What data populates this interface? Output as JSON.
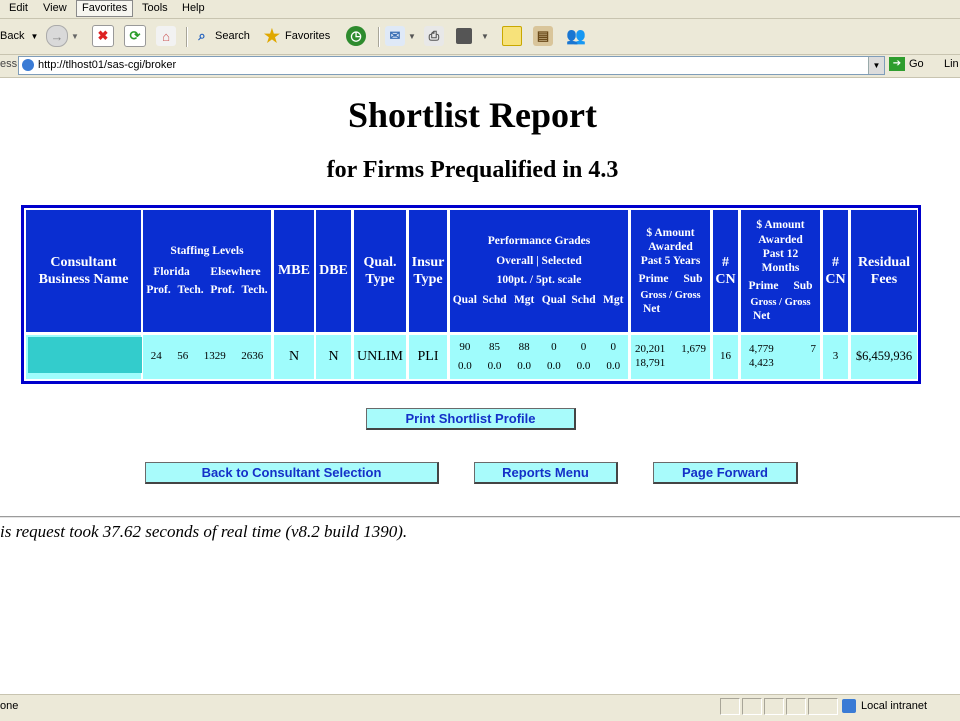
{
  "menu": {
    "items": [
      "Edit",
      "View",
      "Favorites",
      "Tools",
      "Help"
    ],
    "active": "Favorites"
  },
  "toolbar": {
    "back_label": "Back",
    "search_label": "Search",
    "favorites_label": "Favorites"
  },
  "address": {
    "label": "ess",
    "url": "http://tlhost01/sas-cgi/broker",
    "go_label": "Go",
    "links_label": "Lin"
  },
  "page": {
    "title": "Shortlist Report",
    "subtitle": "for Firms Prequalified in 4.3"
  },
  "table": {
    "headers": {
      "consultant": [
        "Consultant",
        "Business Name"
      ],
      "staffing": {
        "title": "Staffing Levels",
        "regions": [
          "Florida",
          "Elsewhere"
        ],
        "sub": [
          "Prof.",
          "Tech.",
          "Prof.",
          "Tech."
        ]
      },
      "mbe": "MBE",
      "dbe": "DBE",
      "qual_type": [
        "Qual.",
        "Type"
      ],
      "insur_type": [
        "Insur",
        "Type"
      ],
      "performance": {
        "l1": "Performance Grades",
        "l2": "Overall | Selected",
        "l3": "100pt. / 5pt. scale",
        "cols": [
          "Qual",
          "Schd",
          "Mgt",
          "Qual",
          "Schd",
          "Mgt"
        ]
      },
      "amount5": {
        "lines": [
          "$ Amount",
          "Awarded",
          "Past 5 Years"
        ],
        "ps": [
          "Prime",
          "Sub"
        ],
        "gg": "Gross / Gross",
        "net": "Net"
      },
      "cn1": [
        "#",
        "CN"
      ],
      "amount12": {
        "lines": [
          "$ Amount",
          "Awarded",
          "Past 12",
          "Months"
        ],
        "ps": [
          "Prime",
          "Sub"
        ],
        "gg": "Gross / Gross",
        "net": "Net"
      },
      "cn2": [
        "#",
        "CN"
      ],
      "residual": [
        "Residual",
        "Fees"
      ]
    },
    "row": {
      "consultant": "",
      "staffing": [
        "24",
        "56",
        "1329",
        "2636"
      ],
      "mbe": "N",
      "dbe": "N",
      "qual_type": "UNLIM",
      "insur_type": "PLI",
      "perf_overall": [
        "90",
        "85",
        "88",
        "0",
        "0",
        "0"
      ],
      "perf_selected": [
        "0.0",
        "0.0",
        "0.0",
        "0.0",
        "0.0",
        "0.0"
      ],
      "amount5": {
        "prime_gross": "20,201",
        "sub_gross": "1,679",
        "net": "18,791"
      },
      "cn1": "16",
      "amount12": {
        "prime_gross": "4,779",
        "sub_gross": "7",
        "net": "4,423"
      },
      "cn2": "3",
      "residual": "$6,459,936"
    }
  },
  "buttons": {
    "print": "Print Shortlist Profile",
    "back": "Back to Consultant Selection",
    "reports": "Reports Menu",
    "forward": "Page Forward"
  },
  "timing": "is request took 37.62 seconds of real time (v8.2 build 1390).",
  "status": {
    "left": "one",
    "zone": "Local intranet"
  }
}
